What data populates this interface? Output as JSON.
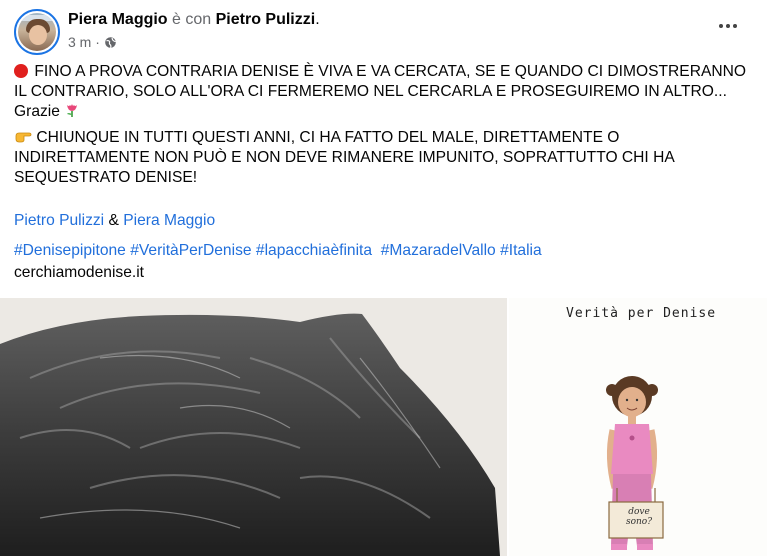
{
  "post": {
    "author": "Piera Maggio",
    "with_text": "è con",
    "tagged": "Pietro Pulizzi",
    "tagged_suffix": ".",
    "time": "3 m ·",
    "more_icon": "ellipsis-icon",
    "privacy_icon": "globe-icon"
  },
  "body": {
    "p1": "FINO A PROVA CONTRARIA DENISE È VIVA E VA CERCATA, SE E QUANDO CI DIMOSTRERANNO IL CONTRARIO, SOLO ALL'ORA CI FERMEREMO NEL CERCARLA E PROSEGUIREMO IN ALTRO... Grazie",
    "p2": "CHIUNQUE IN TUTTI QUESTI ANNI, CI HA FATTO DEL MALE, DIRETTAMENTE O INDIRETTAMENTE NON PUÒ E NON DEVE RIMANERE IMPUNITO, SOPRATTUTTO CHI  HA SEQUESTRATO DENISE!",
    "mention1": "Pietro Pulizzi",
    "amp": "&",
    "mention2": "Piera Maggio",
    "hashtags": [
      "#Denisepipitone",
      "#VeritàPerDenise",
      "#lapacchiaèfinita",
      "#MazaradelVallo",
      "#Italia"
    ],
    "site": "cerchiamodenise.it"
  },
  "images": {
    "right_title": "Verità per Denise",
    "sign_text": "dove sono?"
  },
  "colors": {
    "link": "#216fdb",
    "accent_ring": "#1b74e4",
    "muted": "#65676b",
    "red_dot": "#e0201e"
  }
}
